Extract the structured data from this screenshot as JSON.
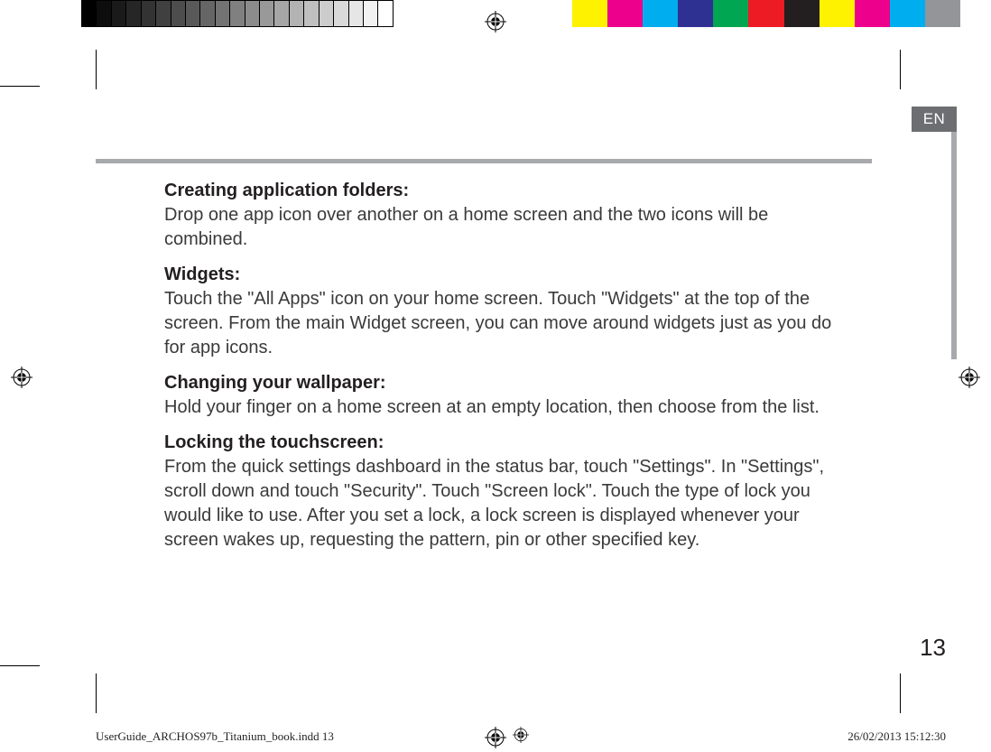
{
  "language_tab": "EN",
  "page_number": "13",
  "sections": [
    {
      "title": "Creating application folders:",
      "body": "Drop one app icon over another on a home screen and the two icons will be combined."
    },
    {
      "title": "Widgets:",
      "body": "Touch the \"All Apps\" icon on your home screen. Touch \"Widgets\" at the top of the screen. From the main Widget screen, you can move around widgets just as you do for app icons."
    },
    {
      "title": "Changing your wallpaper:",
      "body": "Hold your finger on a home screen at an empty location, then choose from the list."
    },
    {
      "title": "Locking the touchscreen:",
      "body": "From the quick settings dashboard in the status bar, touch \"Settings\". In \"Settings\", scroll down and touch \"Security\". Touch \"Screen lock\". Touch the type of lock you would like to use. After you set a lock, a lock screen is displayed whenever your screen wakes up, requesting the pattern, pin or other specified key."
    }
  ],
  "footer": {
    "left": "UserGuide_ARCHOS97b_Titanium_book.indd   13",
    "right": "26/02/2013   15:12:30"
  },
  "colorbar_left": [
    "#000000",
    "#0d0d0d",
    "#1a1a1a",
    "#262626",
    "#333333",
    "#404040",
    "#4d4d4d",
    "#595959",
    "#666666",
    "#737373",
    "#808080",
    "#8c8c8c",
    "#999999",
    "#a6a6a6",
    "#b3b3b3",
    "#bfbfbf",
    "#cccccc",
    "#d9d9d9",
    "#e6e6e6",
    "#f2f2f2",
    "#ffffff"
  ],
  "colorbar_right": [
    "#fff200",
    "#ec008c",
    "#00aeef",
    "#2e3192",
    "#00a651",
    "#ed1c24",
    "#231f20",
    "#fff200",
    "#ec008c",
    "#00aeef",
    "#939598"
  ]
}
